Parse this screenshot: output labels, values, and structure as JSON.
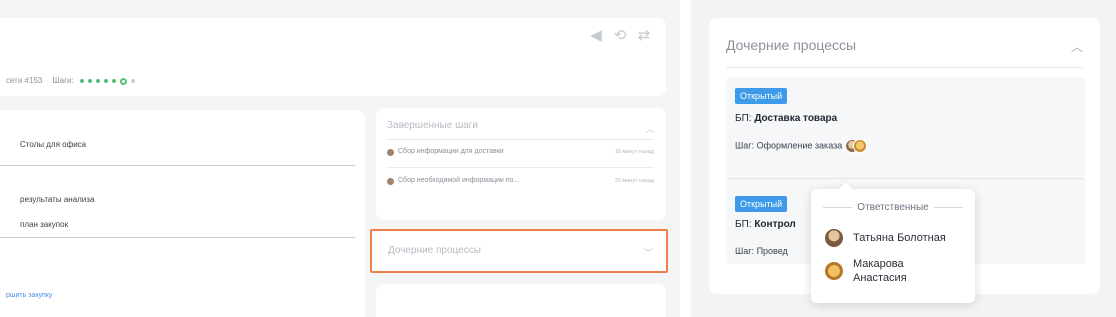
{
  "left": {
    "chain_text": "сети #153",
    "steps_label": "Шаги:",
    "list_items": [
      "Столы для офиса",
      "результаты анализа",
      "план закупок"
    ],
    "bottom_link": "ршить закупку",
    "completed": {
      "title": "Завершенные шаги",
      "rows": [
        {
          "text": "Сбор информации для доставки",
          "time": "18 минут назад"
        },
        {
          "text": "Сбор необходимой информации по...",
          "time": "20 минут назад"
        }
      ]
    },
    "child_title": "Дочерние процессы",
    "highlight_color": "#f0804a"
  },
  "right": {
    "title": "Дочерние процессы",
    "processes": [
      {
        "badge": "Открытый",
        "prefix": "БП:",
        "name": "Доставка товара",
        "step_prefix": "Шаг:",
        "step": "Оформление заказа"
      },
      {
        "badge": "Открытый",
        "prefix": "БП:",
        "name": "Контрол",
        "step_prefix": "Шаг:",
        "step": "Провед"
      }
    ],
    "popover": {
      "heading": "Ответственные",
      "people": [
        "Татьяна Болотная",
        "Макарова Анастасия"
      ]
    },
    "badge_color": "#3d9be9"
  }
}
